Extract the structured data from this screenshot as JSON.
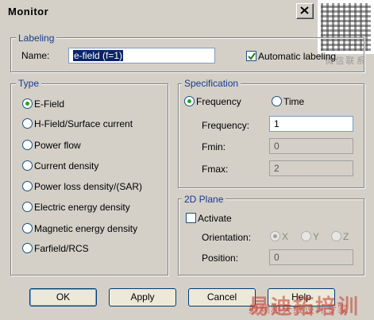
{
  "window": {
    "title": "Monitor"
  },
  "watermark": {
    "qr_tag": "微信联系",
    "brand": "易迪拓培训",
    "tagline": "射频和天线设计专家"
  },
  "labeling": {
    "legend": "Labeling",
    "name_label": "Name:",
    "name_value": "e-field (f=1)",
    "auto_label": "Automatic labeling",
    "auto_checked": true
  },
  "type": {
    "legend": "Type",
    "options": [
      {
        "label": "E-Field",
        "checked": true
      },
      {
        "label": "H-Field/Surface current",
        "checked": false
      },
      {
        "label": "Power flow",
        "checked": false
      },
      {
        "label": "Current density",
        "checked": false
      },
      {
        "label": "Power loss density/(SAR)",
        "checked": false
      },
      {
        "label": "Electric energy density",
        "checked": false
      },
      {
        "label": "Magnetic energy density",
        "checked": false
      },
      {
        "label": "Farfield/RCS",
        "checked": false
      }
    ]
  },
  "specification": {
    "legend": "Specification",
    "mode_frequency": "Frequency",
    "mode_time": "Time",
    "selected_mode": "Frequency",
    "frequency_label": "Frequency:",
    "frequency_value": "1",
    "fmin_label": "Fmin:",
    "fmin_value": "0",
    "fmax_label": "Fmax:",
    "fmax_value": "2"
  },
  "plane2d": {
    "legend": "2D Plane",
    "activate_label": "Activate",
    "activate_checked": false,
    "orientation_label": "Orientation:",
    "axes": [
      "X",
      "Y",
      "Z"
    ],
    "selected_axis": "X",
    "position_label": "Position:",
    "position_value": "0"
  },
  "buttons": {
    "ok": "OK",
    "apply": "Apply",
    "cancel": "Cancel",
    "help": "Help"
  },
  "colors": {
    "group_legend": "#1a3a8c",
    "radio_dot": "#24a424",
    "selection": "#0a246a"
  }
}
